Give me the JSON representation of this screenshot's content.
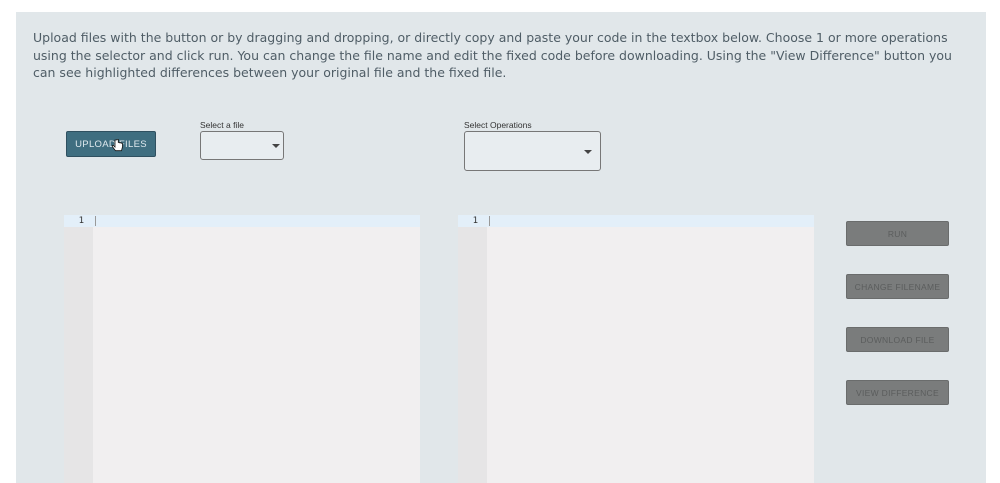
{
  "instructions": "Upload files with the button or by dragging and dropping, or directly copy and paste your code in the textbox below. Choose 1 or more operations using the selector and click run. You can change the file name and edit the fixed code before downloading. Using the \"View Difference\" button you can see highlighted differences between your original file and the fixed file.",
  "upload": {
    "label": "UPLOAD FILES"
  },
  "file_select": {
    "label": "Select a file",
    "value": ""
  },
  "operations_select": {
    "label": "Select Operations",
    "value": ""
  },
  "input_editor": {
    "line_number": "1",
    "content": ""
  },
  "output_editor": {
    "line_number": "1",
    "content": ""
  },
  "actions": {
    "run": "RUN",
    "change_filename": "CHANGE FILENAME",
    "download_file": "DOWNLOAD FILE",
    "view_difference": "VIEW DIFFERENCE"
  },
  "colors": {
    "panel_bg": "#e1e7ea",
    "upload_button": "#3f6e80",
    "disabled_button": "#7a7c7c",
    "editor_bg": "#f1eff0",
    "active_line": "#e3eff9"
  },
  "icons": {
    "cursor": "hand-pointer-icon",
    "dropdown": "caret-down-icon"
  }
}
